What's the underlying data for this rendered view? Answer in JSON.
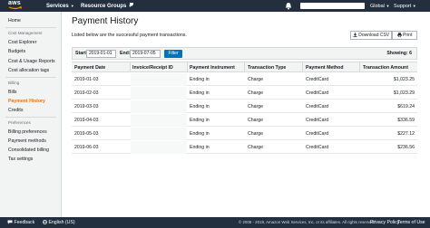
{
  "topnav": {
    "logo_text": "aws",
    "services_label": "Services",
    "resource_groups_label": "Resource Groups",
    "region_label": "Global",
    "support_label": "Support"
  },
  "sidebar": {
    "home": "Home",
    "section_cost_management": "Cost Management",
    "cost_explorer": "Cost Explorer",
    "budgets": "Budgets",
    "cost_usage_reports": "Cost & Usage Reports",
    "cost_allocation_tags": "Cost allocation tags",
    "section_billing": "Billing",
    "bills": "Bills",
    "payment_history": "Payment History",
    "credits": "Credits",
    "section_preferences": "Preferences",
    "billing_preferences": "Billing preferences",
    "payment_methods": "Payment methods",
    "consolidated_billing": "Consolidated billing",
    "tax_settings": "Tax settings"
  },
  "main": {
    "title": "Payment History",
    "subtitle": "Listed below are the successful payment transactions.",
    "download_csv": "Download CSV",
    "print": "Print"
  },
  "filter": {
    "start_label": "Start:",
    "start_value": "2019-01-01",
    "end_label": "End:",
    "end_value": "2019-07-05",
    "filter_button": "Filter",
    "showing": "Showing: 6"
  },
  "table": {
    "headers": [
      "Payment Date",
      "Invoice/Receipt ID",
      "Payment Instrument",
      "Transaction Type",
      "Payment Method",
      "Transaction Amount"
    ],
    "rows": [
      {
        "date": "2019-01-03",
        "invoice": "",
        "instrument": "Ending in",
        "type": "Charge",
        "method": "CreditCard",
        "amount": "$1,023.25"
      },
      {
        "date": "2019-02-03",
        "invoice": "",
        "instrument": "Ending in",
        "type": "Charge",
        "method": "CreditCard",
        "amount": "$1,023.29"
      },
      {
        "date": "2019-03-03",
        "invoice": "",
        "instrument": "Ending in",
        "type": "Charge",
        "method": "CreditCard",
        "amount": "$619.24"
      },
      {
        "date": "2019-04-03",
        "invoice": "",
        "instrument": "Ending in",
        "type": "Charge",
        "method": "CreditCard",
        "amount": "$336.59"
      },
      {
        "date": "2019-05-03",
        "invoice": "",
        "instrument": "Ending in",
        "type": "Charge",
        "method": "CreditCard",
        "amount": "$227.12"
      },
      {
        "date": "2019-06-03",
        "invoice": "",
        "instrument": "Ending in",
        "type": "Charge",
        "method": "CreditCard",
        "amount": "$236.56"
      }
    ]
  },
  "footer": {
    "feedback": "Feedback",
    "language": "English (US)",
    "copyright": "© 2008 - 2019, Amazon Web Services, Inc. or its affiliates. All rights reserved.",
    "privacy_policy": "Privacy Policy",
    "terms_of_use": "Terms of Use"
  },
  "colors": {
    "nav_bg": "#232f3e",
    "accent_orange": "#ec7211",
    "primary_blue": "#0073bb"
  },
  "icons": [
    "aws-logo",
    "bell-icon",
    "download-icon",
    "print-icon",
    "feedback-icon",
    "globe-icon"
  ]
}
